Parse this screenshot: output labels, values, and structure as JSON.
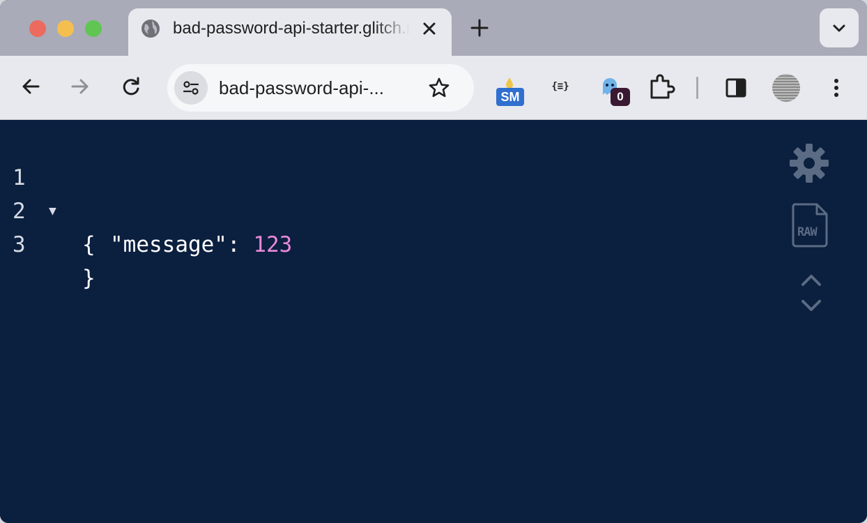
{
  "tab": {
    "title": "bad-password-api-starter.glitch.me"
  },
  "toolbar": {
    "url": "bad-password-api-...",
    "extensions": {
      "sm_badge": "SM",
      "json_label": "{≡}",
      "ghost_count": "0"
    }
  },
  "json_view": {
    "line_numbers": [
      "1",
      "2",
      "3"
    ],
    "open_brace": "{",
    "key": "\"message\"",
    "colon": ": ",
    "value": "123",
    "close_brace": "}",
    "number_color": "#e889d9",
    "background": "#0b1f3f"
  },
  "side_tools": {
    "icons": [
      "gear-icon",
      "raw-icon",
      "chevron-up-icon",
      "chevron-down-icon"
    ],
    "raw_label": "RAW"
  }
}
